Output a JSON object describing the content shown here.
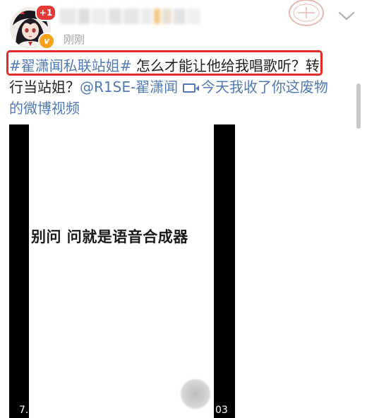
{
  "header": {
    "notification_count": "+1",
    "verified_mark": "v",
    "timestamp": "刚刚",
    "name_blur_colors": [
      "#e8e8e8",
      "#dedede",
      "#ededed",
      "#e2e2e2",
      "#e6e6e6",
      "#ebebeb",
      "#f3c98a",
      "#e9e0d0",
      "#e3e3e3",
      "#f0f0f0"
    ]
  },
  "post": {
    "topic_tag": "#翟潇闻私联站姐#",
    "text_line1_rest": " 怎么才能让他给我唱歌听？转",
    "text_line2_start": "行当站姐？",
    "mention": "@R1SE-翟潇闻",
    "video_link": "今天我收了你这废物",
    "video_link_cont": "的微博视频"
  },
  "video": {
    "caption": "别问 问就是语音合成器",
    "time_left": "7.",
    "time_right": "03"
  },
  "colors": {
    "link": "#5179b5",
    "highlight_border": "#e32b2b",
    "notification_badge": "#e53935",
    "verified_badge": "#f7a21b",
    "timestamp": "#a3a3a3"
  },
  "icons": {
    "expand": "chevron-down-icon",
    "video_link": "video-camera-icon",
    "verified": "verified-badge-icon"
  }
}
